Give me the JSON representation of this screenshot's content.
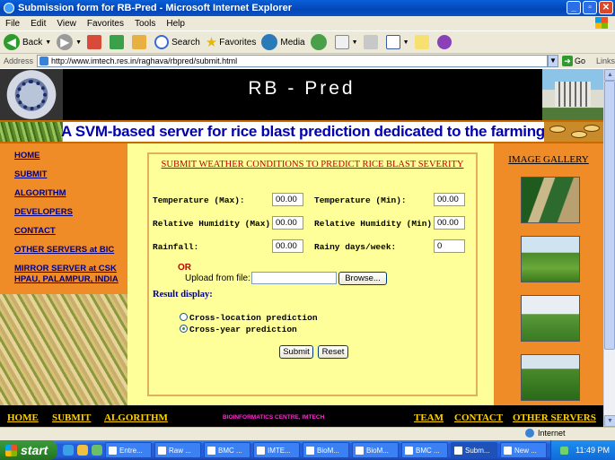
{
  "window": {
    "title": "Submission form for RB-Pred - Microsoft Internet Explorer"
  },
  "menu": [
    "File",
    "Edit",
    "View",
    "Favorites",
    "Tools",
    "Help"
  ],
  "toolbar": {
    "back": "Back",
    "search": "Search",
    "favorites": "Favorites",
    "media": "Media"
  },
  "address": {
    "label": "Address",
    "url": "http://www.imtech.res.in/raghava/rbpred/submit.html",
    "go": "Go",
    "links": "Links"
  },
  "header": {
    "site_title": "RB - Pred",
    "banner": "A SVM-based server for rice blast prediction dedicated to the farming community"
  },
  "nav": [
    "HOME",
    "SUBMIT",
    "ALGORITHM",
    "DEVELOPERS",
    "CONTACT",
    "OTHER SERVERS at BIC",
    "MIRROR SERVER at CSK HPAU, PALAMPUR, INDIA"
  ],
  "form": {
    "title": "SUBMIT WEATHER CONDITIONS TO PREDICT RICE BLAST SEVERITY",
    "fields": {
      "temp_max": {
        "label": "Temperature (Max):",
        "value": "00.00"
      },
      "temp_min": {
        "label": "Temperature (Min):",
        "value": "00.00"
      },
      "rh_max": {
        "label": "Relative Humidity (Max):",
        "value": "00.00"
      },
      "rh_min": {
        "label": "Relative Humidity (Min):",
        "value": "00.00"
      },
      "rainfall": {
        "label": "Rainfall:",
        "value": "00.00"
      },
      "rainy_days": {
        "label": "Rainy days/week:",
        "value": "0"
      }
    },
    "or": "OR",
    "upload_label": "Upload from file:",
    "browse": "Browse...",
    "result_label": "Result display:",
    "options": {
      "cross_location": "Cross-location prediction",
      "cross_year": "Cross-year prediction"
    },
    "selected": "cross_year",
    "submit": "Submit",
    "reset": "Reset"
  },
  "gallery": {
    "title": "IMAGE GALLERY"
  },
  "footer": {
    "home": "HOME",
    "submit": "SUBMIT",
    "algorithm": "ALGORITHM",
    "centre": "BIOINFORMATICS CENTRE, IMTECH",
    "team": "TEAM",
    "contact": "CONTACT",
    "other_servers": "OTHER SERVERS"
  },
  "status": {
    "zone": "Internet"
  },
  "taskbar": {
    "start": "start",
    "tasks": [
      "Entre...",
      "Raw ...",
      "BMC ...",
      "IMTE...",
      "BioM...",
      "BioM...",
      "BMC ...",
      "Subm...",
      "New ..."
    ],
    "clock": "11:49 PM"
  }
}
